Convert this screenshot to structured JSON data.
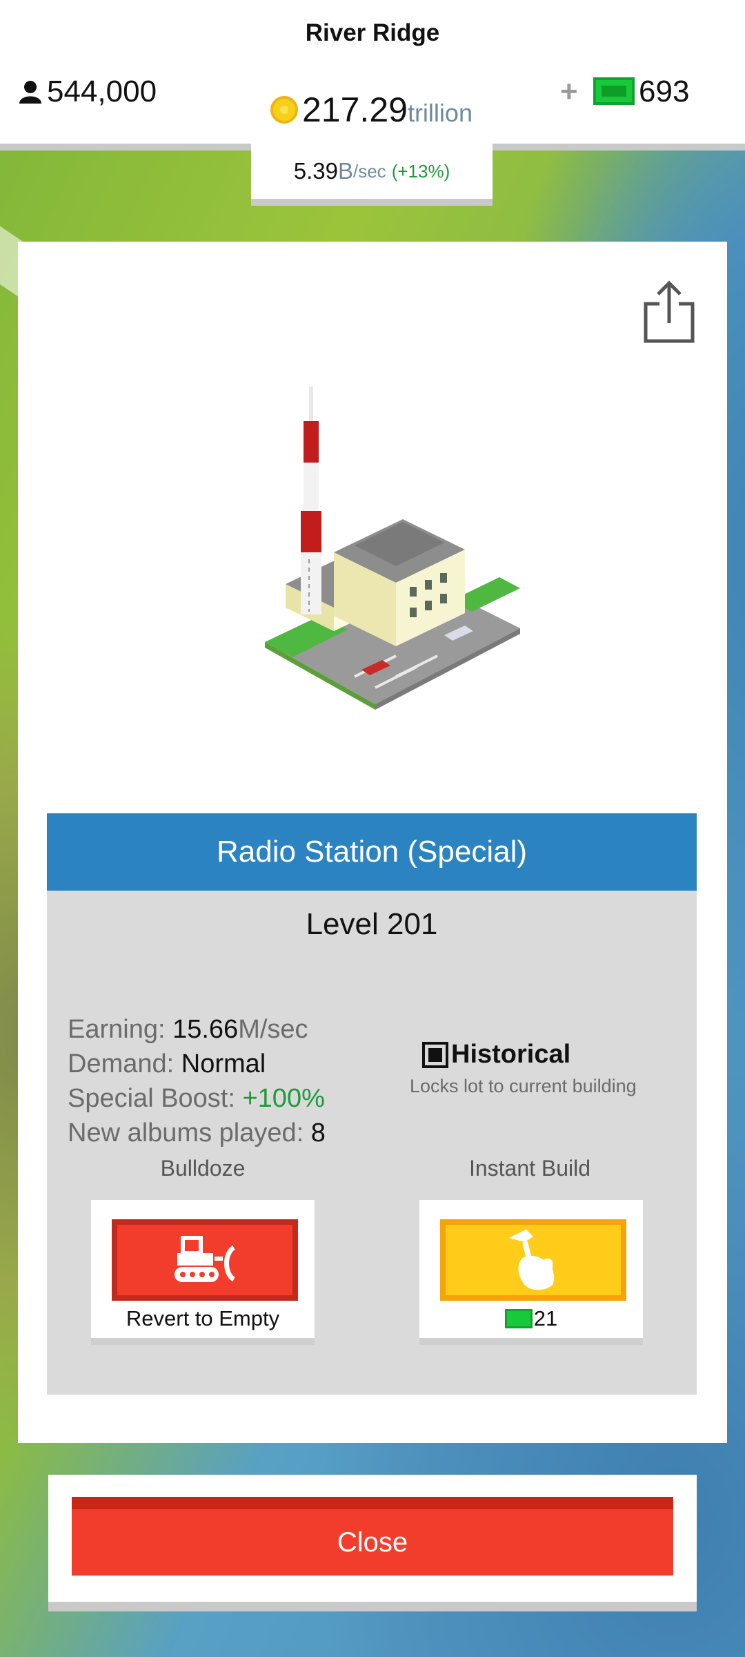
{
  "header": {
    "city_name": "River Ridge",
    "population": "544,000",
    "coins_value": "217.29",
    "coins_unit": "trillion",
    "plus_label": "+",
    "cash_value": "693",
    "rate_value": "5.39",
    "rate_unit": "B",
    "rate_per": "/sec",
    "rate_pct": "(+13%)"
  },
  "building": {
    "title": "Radio Station (Special)",
    "level": "Level 201",
    "stats": {
      "earning_label": "Earning: ",
      "earning_value": "15.66",
      "earning_unit": "M/sec",
      "demand_label": "Demand: ",
      "demand_value": "Normal",
      "boost_label": "Special Boost: ",
      "boost_value": "+100%",
      "albums_label": "New albums played: ",
      "albums_value": "8"
    },
    "historical": {
      "label": "Historical",
      "description": "Locks lot to current building",
      "checked": true
    }
  },
  "actions": {
    "bulldoze_label": "Bulldoze",
    "bulldoze_caption": "Revert to Empty",
    "instant_label": "Instant Build",
    "instant_cost": "21"
  },
  "footer": {
    "close_label": "Close"
  },
  "icons": {
    "population": "person-icon",
    "coins": "coin-icon",
    "cash": "cash-icon",
    "share": "share-icon",
    "bulldozer": "bulldozer-icon",
    "hammer": "hammer-icon",
    "checkbox": "checkbox-icon"
  },
  "colors": {
    "header_blue": "#2b84c1",
    "close_red": "#f23d2c",
    "instant_yellow": "#ffcc1a",
    "cash_green": "#18c93b",
    "positive_green": "#1f9a3a"
  }
}
